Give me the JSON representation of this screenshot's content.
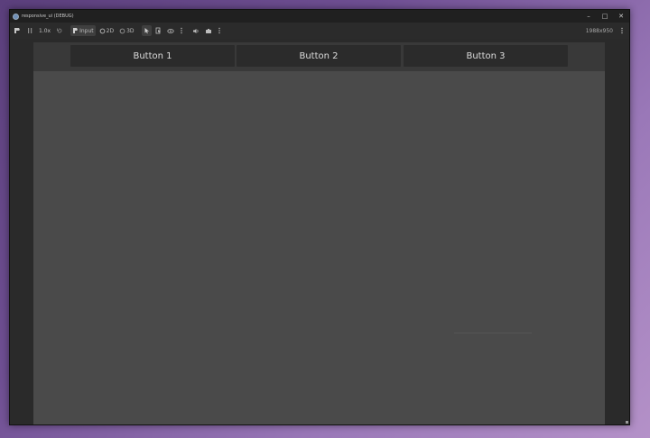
{
  "window": {
    "title": "responsive_ui (DEBUG)",
    "controls": {
      "minimize": "–",
      "maximize": "□",
      "close": "✕"
    }
  },
  "toolbar": {
    "speed": "1.0x",
    "input_label": "Input",
    "mode_2d": "2D",
    "mode_3d": "3D",
    "resolution": "1988x950"
  },
  "game": {
    "buttons": [
      "Button 1",
      "Button 2",
      "Button 3"
    ]
  }
}
